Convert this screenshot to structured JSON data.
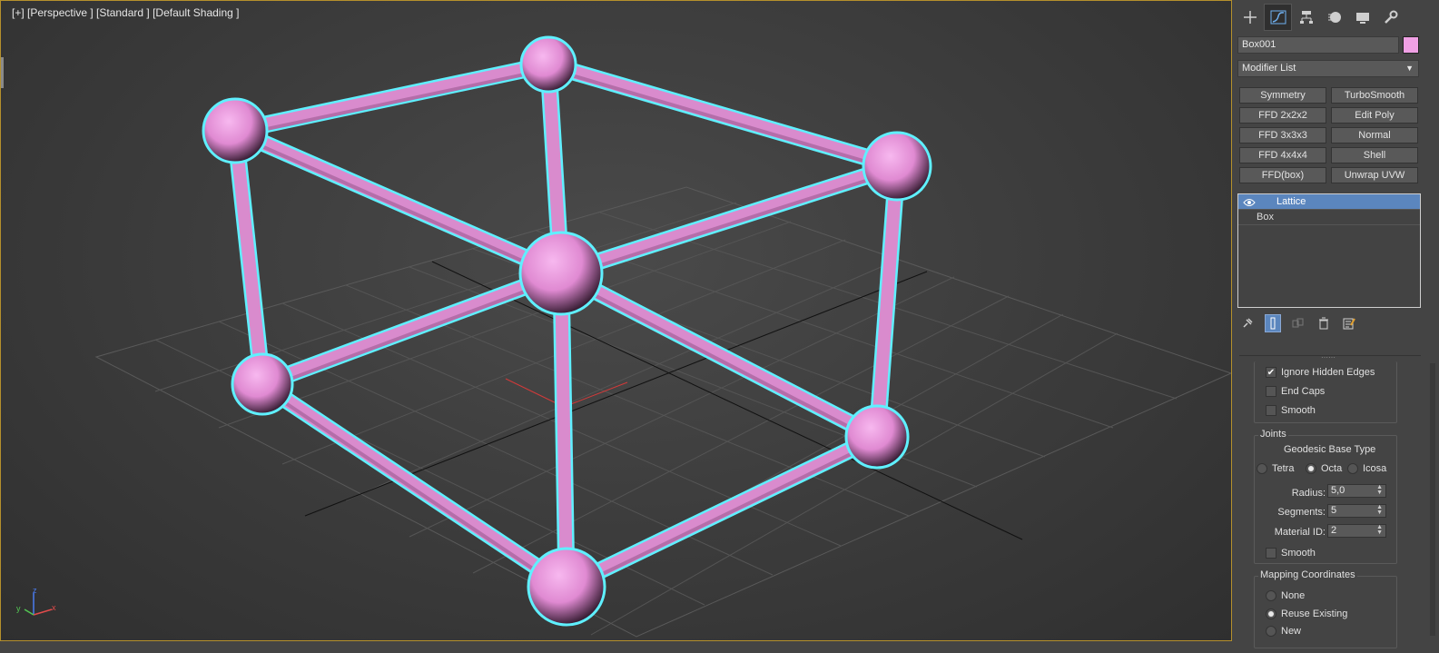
{
  "viewport": {
    "label": "[+] [Perspective ] [Standard ] [Default Shading ]",
    "axis": {
      "z": "z",
      "y": "y",
      "x": "x"
    },
    "object_color": "#e28ad4",
    "selection_color": "#5ff0ff",
    "gizmo_label": "z"
  },
  "command_panel": {
    "tabs": [
      {
        "icon": "plus-icon",
        "glyph": "+"
      },
      {
        "icon": "modify-icon",
        "glyph": "⟋"
      },
      {
        "icon": "hierarchy-icon",
        "glyph": "⊤"
      },
      {
        "icon": "motion-icon",
        "glyph": "●"
      },
      {
        "icon": "display-icon",
        "glyph": "▬"
      },
      {
        "icon": "utilities-icon",
        "glyph": "🔧"
      }
    ],
    "object_name": "Box001",
    "object_color": "#f0a0e4",
    "modifier_list_label": "Modifier List",
    "modifier_buttons": [
      "Symmetry",
      "TurboSmooth",
      "FFD 2x2x2",
      "Edit Poly",
      "FFD 3x3x3",
      "Normal",
      "FFD 4x4x4",
      "Shell",
      "FFD(box)",
      "Unwrap UVW"
    ],
    "stack": [
      {
        "label": "Lattice"
      },
      {
        "label": "Box"
      }
    ]
  },
  "lattice_params": {
    "ignore_hidden_edges": {
      "label": "Ignore Hidden Edges",
      "checked": true
    },
    "end_caps": {
      "label": "End Caps",
      "checked": false
    },
    "smooth_struts": {
      "label": "Smooth",
      "checked": false
    },
    "joints": {
      "title": "Joints",
      "geodesic_title": "Geodesic Base Type",
      "types": [
        {
          "label": "Tetra",
          "selected": false
        },
        {
          "label": "Octa",
          "selected": true
        },
        {
          "label": "Icosa",
          "selected": false
        }
      ],
      "radius": {
        "label": "Radius:",
        "value": "5,0"
      },
      "segments": {
        "label": "Segments:",
        "value": "5"
      },
      "material_id": {
        "label": "Material ID:",
        "value": "2"
      },
      "smooth": {
        "label": "Smooth",
        "checked": false
      }
    },
    "mapping": {
      "title": "Mapping Coordinates",
      "options": [
        {
          "label": "None",
          "selected": false
        },
        {
          "label": "Reuse Existing",
          "selected": true
        },
        {
          "label": "New",
          "selected": false
        }
      ]
    }
  }
}
